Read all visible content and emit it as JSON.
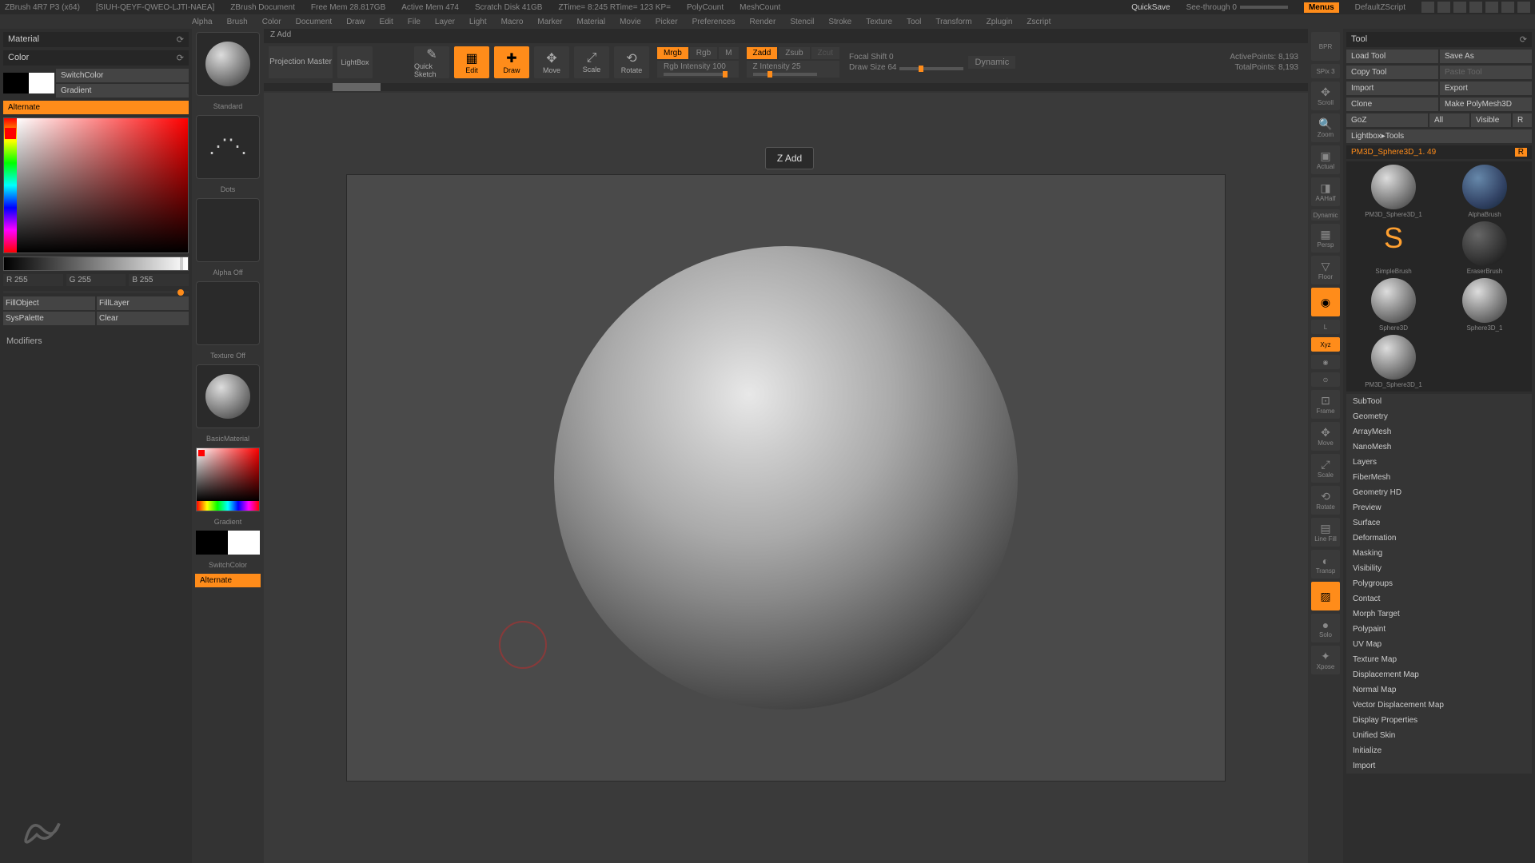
{
  "titlebar": {
    "app": "ZBrush 4R7 P3 (x64)",
    "license": "[SIUH-QEYF-QWEO-LJTI-NAEA]",
    "doc": "ZBrush Document",
    "freemem": "Free Mem 28.817GB",
    "activemem": "Active Mem 474",
    "scratch": "Scratch Disk 41GB",
    "ztime": "ZTime= 8:245 RTime= 123 KP=",
    "polycount": "PolyCount",
    "meshcount": "MeshCount",
    "quicksave": "QuickSave",
    "seethrough": "See-through 0",
    "menus": "Menus",
    "script": "DefaultZScript"
  },
  "menubar": [
    "Alpha",
    "Brush",
    "Color",
    "Document",
    "Draw",
    "Edit",
    "File",
    "Layer",
    "Light",
    "Macro",
    "Marker",
    "Material",
    "Movie",
    "Picker",
    "Preferences",
    "Render",
    "Stencil",
    "Stroke",
    "Texture",
    "Tool",
    "Transform",
    "Zplugin",
    "Zscript"
  ],
  "leftPanel": {
    "material": "Material",
    "color": "Color",
    "switchColor": "SwitchColor",
    "gradient": "Gradient",
    "alternate": "Alternate",
    "r": "R 255",
    "g": "G 255",
    "b": "B 255",
    "fillObject": "FillObject",
    "fillLayer": "FillLayer",
    "sysPalette": "SysPalette",
    "clear": "Clear",
    "modifiers": "Modifiers"
  },
  "brushCol": {
    "standard": "Standard",
    "dots": "Dots",
    "alphaOff": "Alpha Off",
    "textureOff": "Texture Off",
    "basicMaterial": "BasicMaterial",
    "gradient": "Gradient",
    "switchColor": "SwitchColor",
    "alternate": "Alternate"
  },
  "status": "Z Add",
  "toolbar": {
    "projMaster": "Projection Master",
    "lightbox": "LightBox",
    "quickSketch": "Quick Sketch",
    "edit": "Edit",
    "draw": "Draw",
    "move": "Move",
    "scale": "Scale",
    "rotate": "Rotate",
    "mrgb": "Mrgb",
    "rgb": "Rgb",
    "m": "M",
    "rgbIntensity": "Rgb Intensity 100",
    "zadd": "Zadd",
    "zsub": "Zsub",
    "zcut": "Zcut",
    "zIntensity": "Z Intensity 25",
    "focalShift": "Focal Shift 0",
    "drawSize": "Draw Size 64",
    "dynamic": "Dynamic",
    "activePoints": "ActivePoints: 8,193",
    "totalPoints": "TotalPoints: 8,193"
  },
  "tooltip": "Z Add",
  "rightIcons": {
    "bpr": "BPR",
    "spix": "SPix 3",
    "scroll": "Scroll",
    "zoom": "Zoom",
    "actual": "Actual",
    "aahalf": "AAHalf",
    "persp": "Persp",
    "floor": "Floor",
    "local": "Local",
    "frame": "Frame",
    "move": "Move",
    "scale": "Scale",
    "rotate": "Rotate",
    "linefill": "Line Fill",
    "transp": "Transp",
    "ghost": "Ghost",
    "solo": "Solo",
    "xpose": "Xpose",
    "dynamic": "Dynamic",
    "l": "L",
    "xyz": "Xyz"
  },
  "rightPanel": {
    "tool": "Tool",
    "loadTool": "Load Tool",
    "saveAs": "Save As",
    "copyTool": "Copy Tool",
    "pasteTool": "Paste Tool",
    "import": "Import",
    "export": "Export",
    "clone": "Clone",
    "makePM": "Make PolyMesh3D",
    "goz": "GoZ",
    "all": "All",
    "visible": "Visible",
    "r": "R",
    "lightboxTools": "Lightbox▸Tools",
    "toolName": "PM3D_Sphere3D_1. 49",
    "thumbs": {
      "t1": "PM3D_Sphere3D_1",
      "t2": "AlphaBrush",
      "t3": "SimpleBrush",
      "t4": "EraserBrush",
      "t5": "Sphere3D",
      "t6": "Sphere3D_1",
      "t7": "PM3D_Sphere3D_1"
    },
    "accordion": [
      "SubTool",
      "Geometry",
      "ArrayMesh",
      "NanoMesh",
      "Layers",
      "FiberMesh",
      "Geometry HD",
      "Preview",
      "Surface",
      "Deformation",
      "Masking",
      "Visibility",
      "Polygroups",
      "Contact",
      "Morph Target",
      "Polypaint",
      "UV Map",
      "Texture Map",
      "Displacement Map",
      "Normal Map",
      "Vector Displacement Map",
      "Display Properties",
      "Unified Skin",
      "Initialize",
      "Import"
    ]
  }
}
